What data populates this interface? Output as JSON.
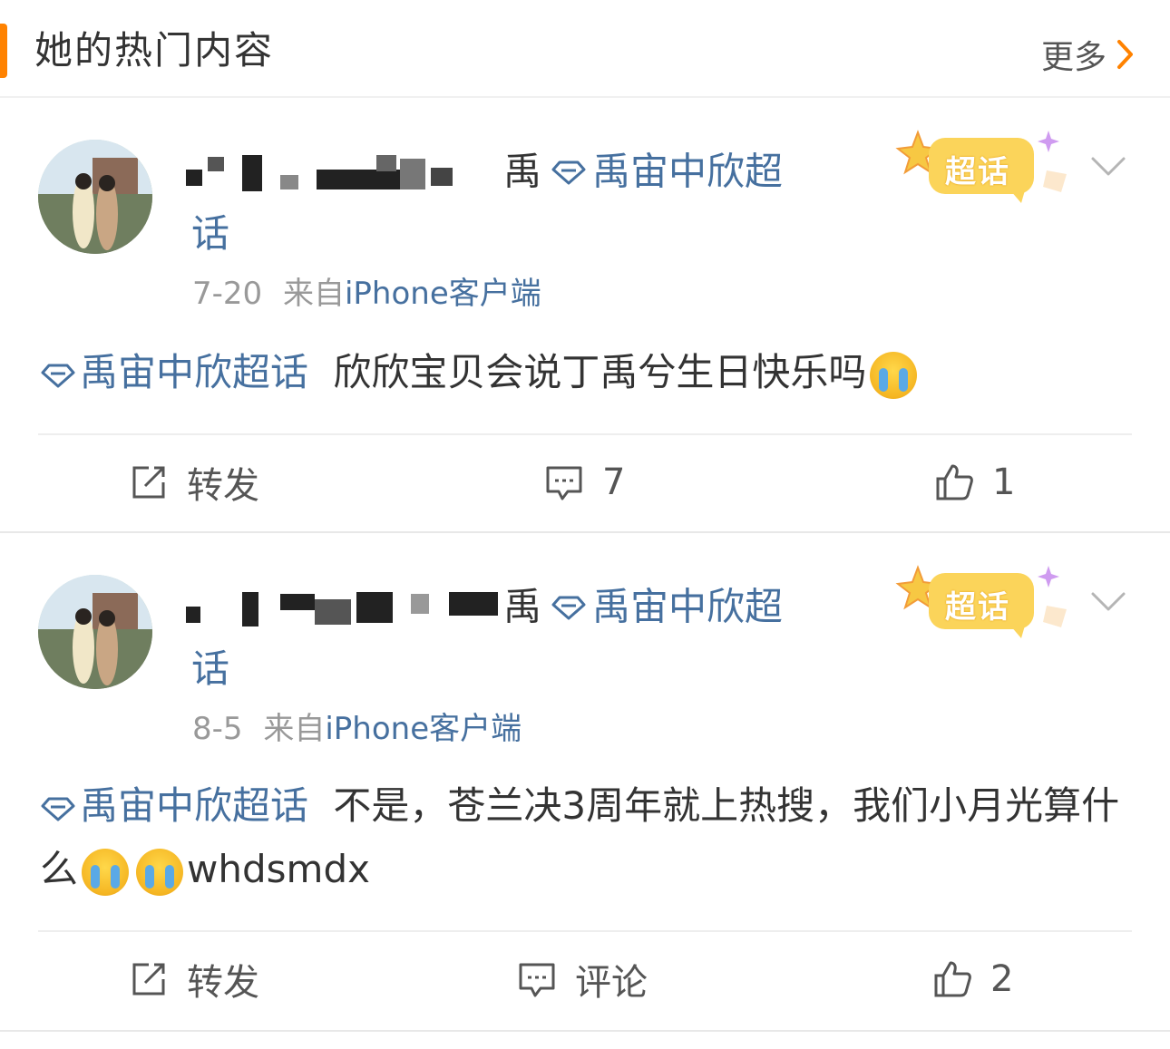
{
  "header": {
    "title": "她的热门内容",
    "more_label": "更多"
  },
  "posts": [
    {
      "name_tail": "禹",
      "topic": "禹宙中欣超",
      "topic_wrap": "话",
      "date": "7-20",
      "from_label": "来自",
      "source": "iPhone客户端",
      "badge": "超话",
      "content_topic": "禹宙中欣超话",
      "content_text": "欣欣宝贝会说丁禹兮生日快乐吗",
      "emoji": "crying-face",
      "actions": {
        "repost": "转发",
        "comment": "7",
        "like": "1"
      }
    },
    {
      "name_tail": "禹",
      "topic": "禹宙中欣超",
      "topic_wrap": "话",
      "date": "8-5",
      "from_label": "来自",
      "source": "iPhone客户端",
      "badge": "超话",
      "content_topic": "禹宙中欣超话",
      "content_text": "不是，苍兰决3周年就上热搜，我们小月光算什么",
      "content_tail": "whdsmdx",
      "emoji": "crying-face",
      "actions": {
        "repost": "转发",
        "comment": "评论",
        "like": "2"
      }
    }
  ],
  "colors": {
    "accent": "#ff8200",
    "link": "#46709f",
    "text": "#333333",
    "muted": "#999999"
  }
}
